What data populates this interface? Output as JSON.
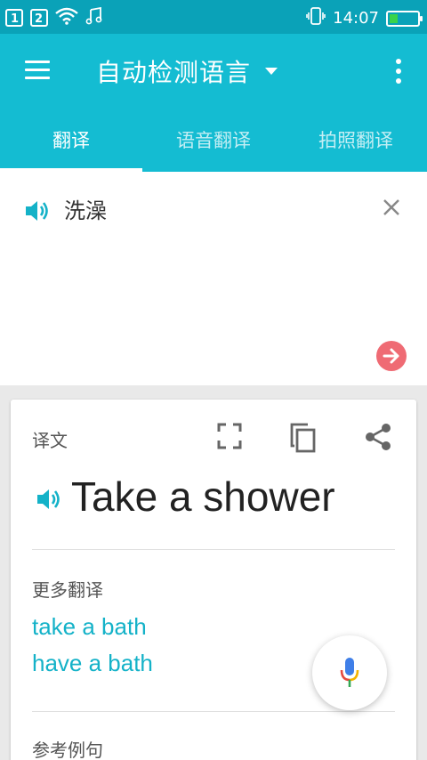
{
  "status_bar": {
    "sim1": "1",
    "sim2": "2",
    "time": "14:07",
    "battery_level_percent": 30,
    "icons": [
      "sim1-icon",
      "sim2-icon",
      "wifi-icon",
      "music-note-icon",
      "vibrate-icon",
      "battery-icon"
    ]
  },
  "app_bar": {
    "source_language": "自动检测语言",
    "menu_icon": "menu-icon",
    "more_icon": "more-vert-icon",
    "color": "#14bcd2"
  },
  "tabs": [
    {
      "label": "翻译",
      "active": true
    },
    {
      "label": "语音翻译",
      "active": false
    },
    {
      "label": "拍照翻译",
      "active": false
    }
  ],
  "input": {
    "text": "洗澡",
    "clear_icon": "close-icon",
    "submit_icon": "arrow-right-icon"
  },
  "result": {
    "label": "译文",
    "translation": "Take a shower",
    "actions": [
      "fullscreen-icon",
      "copy-icon",
      "share-icon"
    ],
    "more_label": "更多翻译",
    "alternatives": [
      "take a bath",
      "have a bath"
    ],
    "examples_label": "参考例句"
  },
  "fab": {
    "icon": "mic-icon"
  },
  "colors": {
    "accent": "#14bcd2",
    "status_bar": "#0aa2b8",
    "go_button": "#ef6b74",
    "link": "#14b2c8"
  }
}
